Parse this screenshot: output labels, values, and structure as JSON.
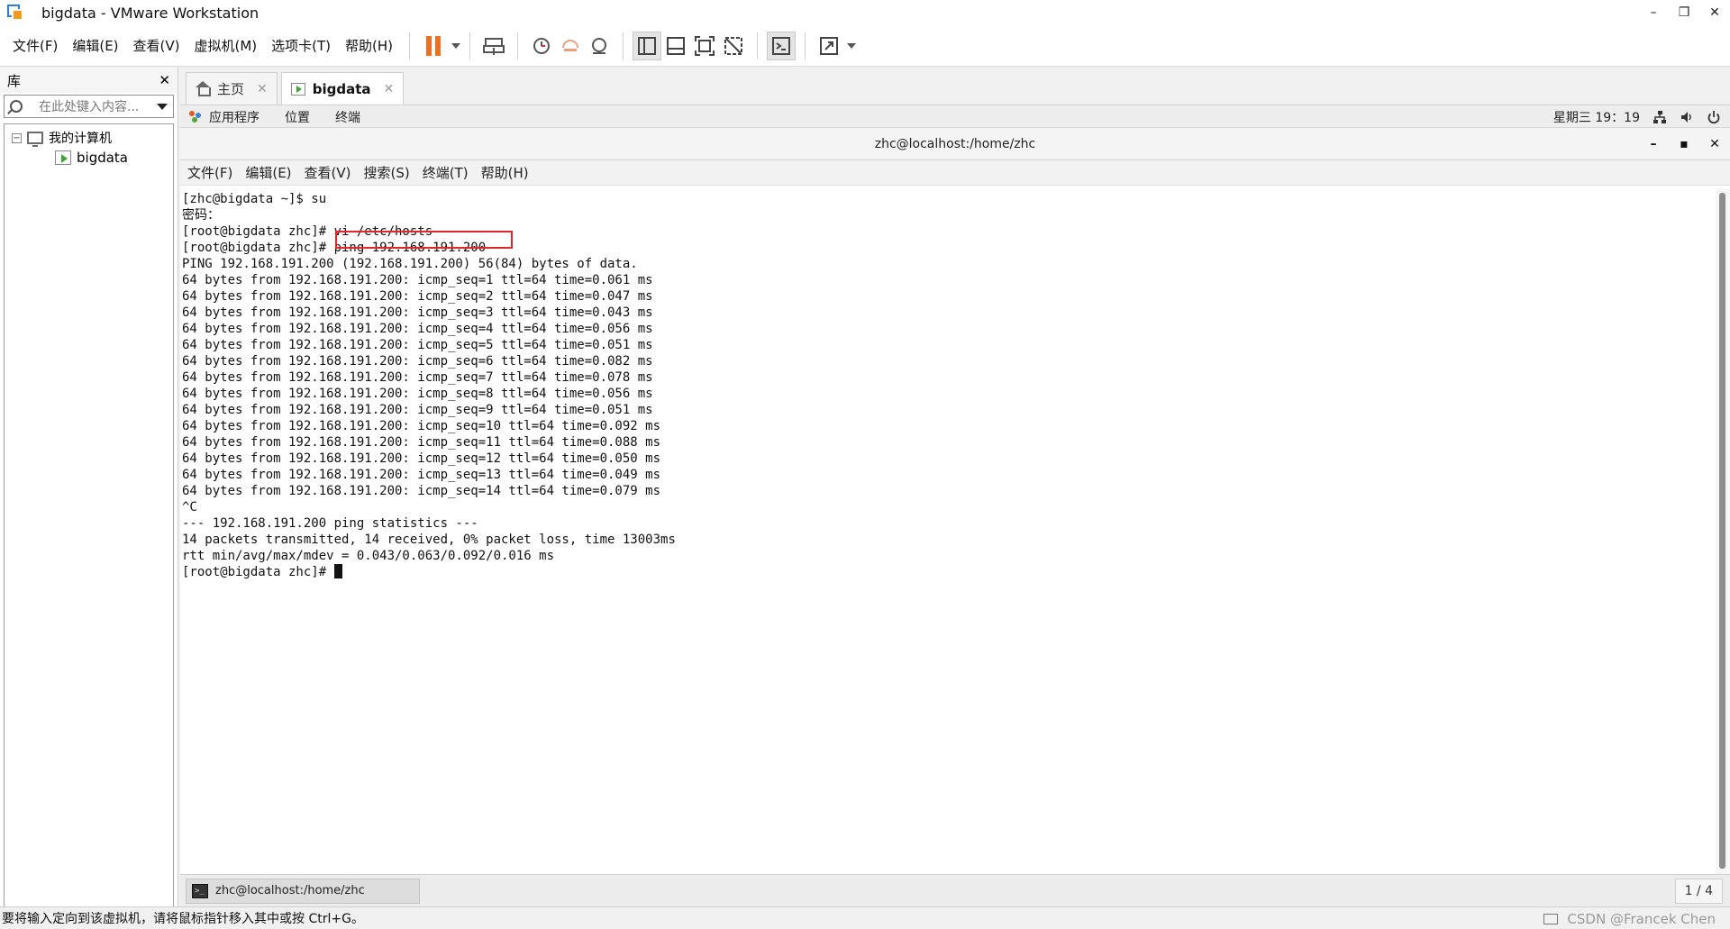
{
  "window": {
    "title": "bigdata - VMware Workstation",
    "controls": [
      "–",
      "❐",
      "✕"
    ]
  },
  "menu": [
    "文件(F)",
    "编辑(E)",
    "查看(V)",
    "虚拟机(M)",
    "选项卡(T)",
    "帮助(H)"
  ],
  "library": {
    "title": "库",
    "close": "✕",
    "search_placeholder": "在此处键入内容...",
    "tree": {
      "root": "我的计算机",
      "expander": "−",
      "child": "bigdata"
    }
  },
  "tabs": [
    {
      "label": "主页",
      "icon": "home-icon"
    },
    {
      "label": "bigdata",
      "icon": "vm-icon"
    }
  ],
  "tab_close": "✕",
  "gnome": {
    "menus": [
      "应用程序",
      "位置",
      "终端"
    ],
    "clock": "星期三 19：19"
  },
  "terminal": {
    "title": "zhc@localhost:/home/zhc",
    "controls": [
      "–",
      "▪",
      "✕"
    ],
    "menu": [
      "文件(F)",
      "编辑(E)",
      "查看(V)",
      "搜索(S)",
      "终端(T)",
      "帮助(H)"
    ],
    "lines": [
      "[zhc@bigdata ~]$ su",
      "密码：",
      "[root@bigdata zhc]# vi /etc/hosts",
      "[root@bigdata zhc]# ping 192.168.191.200",
      "PING 192.168.191.200 (192.168.191.200) 56(84) bytes of data.",
      "64 bytes from 192.168.191.200: icmp_seq=1 ttl=64 time=0.061 ms",
      "64 bytes from 192.168.191.200: icmp_seq=2 ttl=64 time=0.047 ms",
      "64 bytes from 192.168.191.200: icmp_seq=3 ttl=64 time=0.043 ms",
      "64 bytes from 192.168.191.200: icmp_seq=4 ttl=64 time=0.056 ms",
      "64 bytes from 192.168.191.200: icmp_seq=5 ttl=64 time=0.051 ms",
      "64 bytes from 192.168.191.200: icmp_seq=6 ttl=64 time=0.082 ms",
      "64 bytes from 192.168.191.200: icmp_seq=7 ttl=64 time=0.078 ms",
      "64 bytes from 192.168.191.200: icmp_seq=8 ttl=64 time=0.056 ms",
      "64 bytes from 192.168.191.200: icmp_seq=9 ttl=64 time=0.051 ms",
      "64 bytes from 192.168.191.200: icmp_seq=10 ttl=64 time=0.092 ms",
      "64 bytes from 192.168.191.200: icmp_seq=11 ttl=64 time=0.088 ms",
      "64 bytes from 192.168.191.200: icmp_seq=12 ttl=64 time=0.050 ms",
      "64 bytes from 192.168.191.200: icmp_seq=13 ttl=64 time=0.049 ms",
      "64 bytes from 192.168.191.200: icmp_seq=14 ttl=64 time=0.079 ms",
      "^C",
      "--- 192.168.191.200 ping statistics ---",
      "14 packets transmitted, 14 received, 0% packet loss, time 13003ms",
      "rtt min/avg/max/mdev = 0.043/0.063/0.092/0.016 ms"
    ],
    "prompt": "[root@bigdata zhc]# "
  },
  "taskbar": {
    "item": "zhc@localhost:/home/zhc",
    "pager": "1 / 4"
  },
  "statusbar": {
    "message": "要将输入定向到该虚拟机，请将鼠标指针移入其中或按 Ctrl+G。",
    "watermark": "CSDN @Francek Chen"
  },
  "colors": {
    "highlight_box": "#e2262a",
    "pause": "#ee6f1d"
  }
}
